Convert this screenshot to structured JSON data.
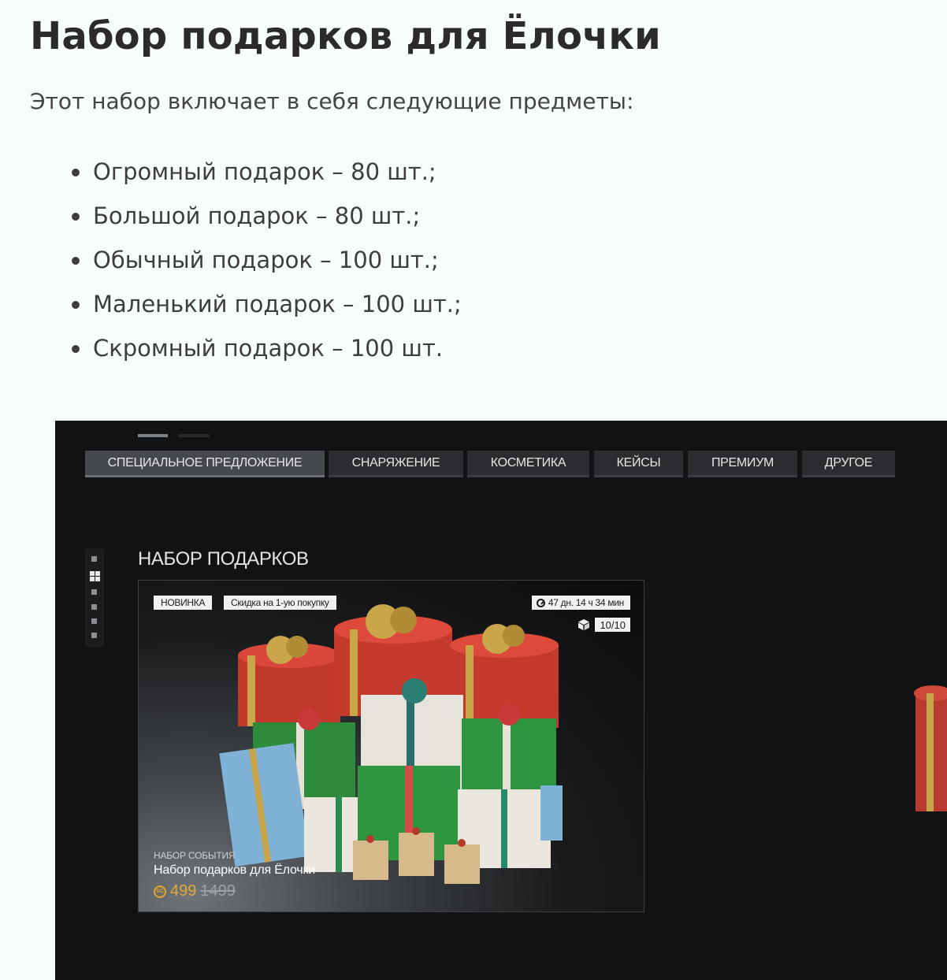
{
  "article": {
    "title": "Набор подарков для Ёлочки",
    "intro": "Этот набор включает в себя следующие предметы:",
    "items": [
      "Огромный подарок – 80 шт.;",
      "Большой подарок – 80 шт.;",
      "Обычный подарок – 100 шт.;",
      "Маленький подарок – 100 шт.;",
      "Скромный подарок – 100 шт."
    ]
  },
  "shop": {
    "tabs": [
      {
        "label": "СПЕЦИАЛЬНОЕ ПРЕДЛОЖЕНИЕ",
        "active": true
      },
      {
        "label": "СНАРЯЖЕНИЕ",
        "active": false
      },
      {
        "label": "КОСМЕТИКА",
        "active": false
      },
      {
        "label": "КЕЙСЫ",
        "active": false
      },
      {
        "label": "ПРЕМИУМ",
        "active": false
      },
      {
        "label": "ДРУГОЕ",
        "active": false
      }
    ],
    "section_title": "НАБОР ПОДАРКОВ",
    "card": {
      "badge_new": "НОВИНКА",
      "badge_discount": "Скидка на 1-ую покупку",
      "timer": "47 дн. 14 ч 34 мин",
      "quantity": "10/10",
      "caption_type": "НАБОР СОБЫТИЯ",
      "caption_name": "Набор подарков для Ёлочки",
      "coin_symbol": "SC",
      "price_now": "499",
      "price_old": "1499"
    },
    "icons": [
      "clock-icon",
      "box-icon",
      "coin-icon",
      "grid-icon"
    ],
    "colors": {
      "price": "#e6a93a",
      "background": "#111213",
      "tab_active": "#45484c",
      "tab": "#2a2c2f"
    }
  }
}
